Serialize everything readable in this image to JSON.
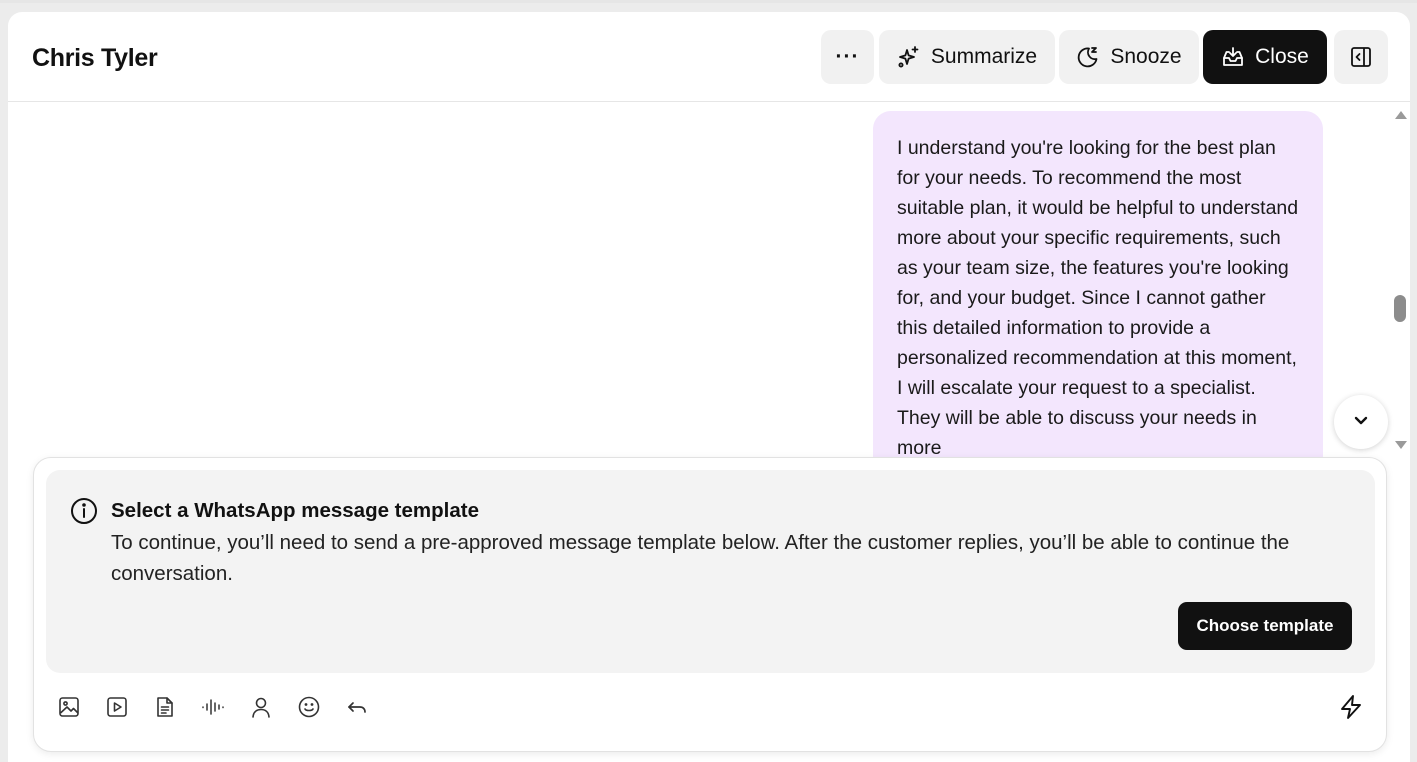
{
  "conversation": {
    "contact_name": "Chris Tyler"
  },
  "header_actions": {
    "more_label": "···",
    "summarize_label": "Summarize",
    "snooze_label": "Snooze",
    "close_label": "Close"
  },
  "messages": [
    {
      "direction": "outgoing",
      "text": "I understand you're looking for the best plan for your needs. To recommend the most suitable plan, it would be helpful to understand more about your specific requirements, such as your team size, the features you're looking for, and your budget. Since I cannot gather this detailed information to provide a personalized recommendation at this moment, I will escalate your request to a specialist. They will be able to discuss your needs in more"
    }
  ],
  "template_notice": {
    "title": "Select a WhatsApp message template",
    "body": "To continue, you’ll need to send a pre-approved message template below. After the customer replies, you’ll be able to continue the conversation.",
    "button_label": "Choose template"
  },
  "composer_tools": [
    "image-icon",
    "video-icon",
    "document-icon",
    "audio-icon",
    "contact-icon",
    "emoji-icon",
    "reply-icon",
    "bolt-icon"
  ],
  "colors": {
    "accent": "#111111",
    "bubble": "#f3e6fd",
    "notice_bg": "#f3f3f3"
  }
}
